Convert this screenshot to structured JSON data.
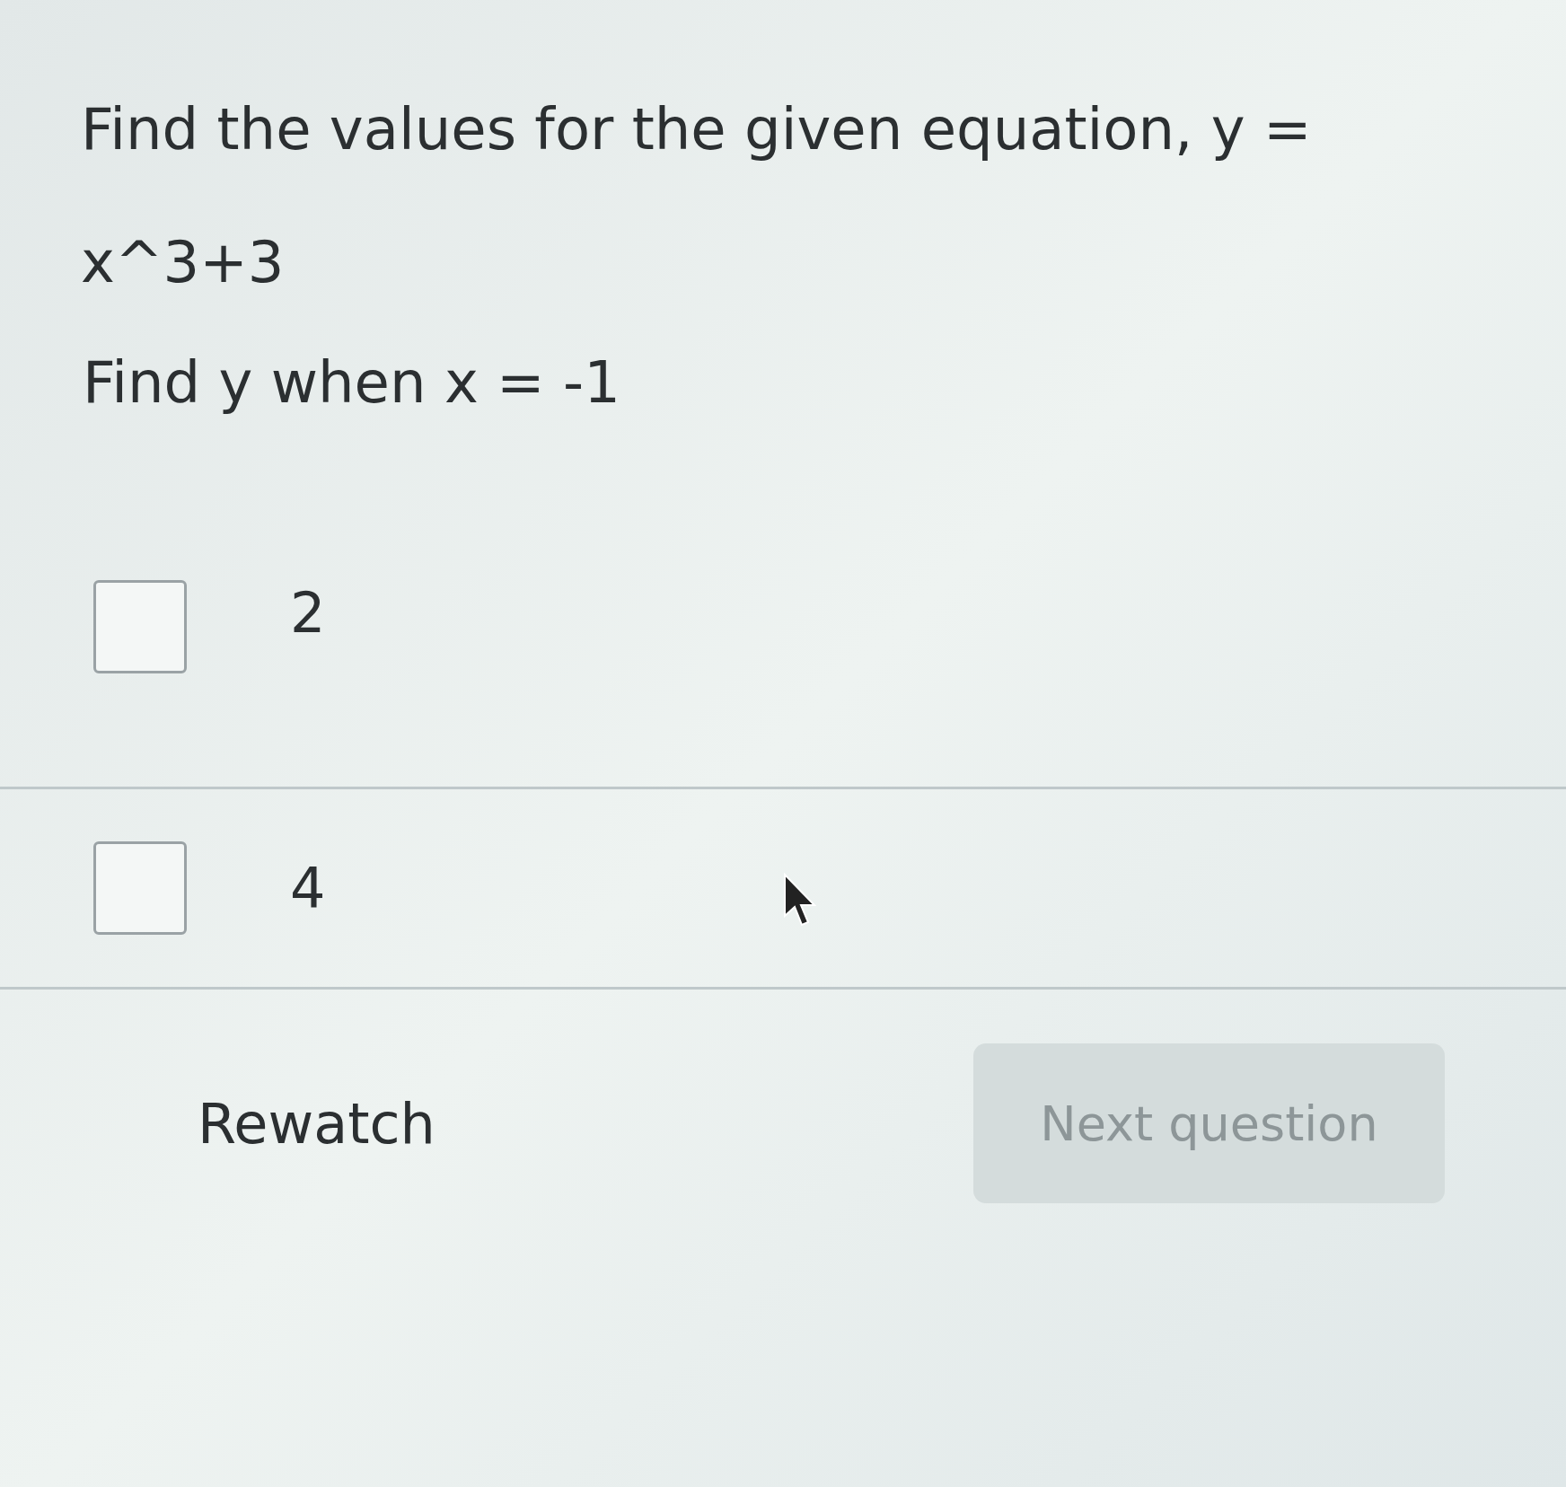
{
  "question": "Find the values for the given equation, y = x^3+3",
  "prompt": "Find y when x = -1",
  "options": [
    {
      "label": "2",
      "checked": false
    },
    {
      "label": "4",
      "checked": false
    }
  ],
  "rewatch": "Rewatch",
  "next": {
    "label": "Next question",
    "disabled": true
  }
}
